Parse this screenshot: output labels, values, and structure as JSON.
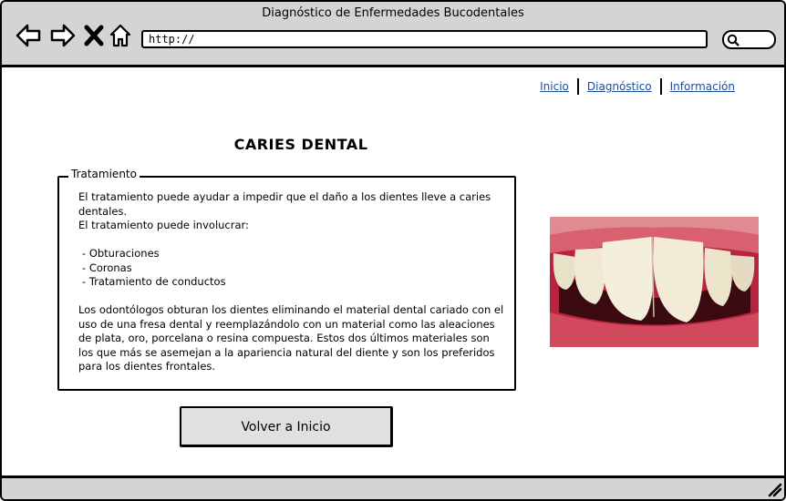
{
  "window": {
    "title": "Diagnóstico de Enfermedades Bucodentales",
    "url": "http://"
  },
  "toolbar": {
    "back_icon": "arrow-left-icon",
    "forward_icon": "arrow-right-icon",
    "stop_icon": "close-icon",
    "home_icon": "home-icon",
    "search_icon": "search-icon"
  },
  "nav": {
    "links": [
      "Inicio",
      "Diagnóstico",
      "Información"
    ]
  },
  "page": {
    "title": "CARIES DENTAL"
  },
  "treatment": {
    "legend": "Tratamiento",
    "intro": "El tratamiento puede ayudar a impedir que el daño a los dientes lleve a caries dentales.",
    "lead": "El tratamiento puede involucrar:",
    "options": [
      "Obturaciones",
      "Coronas",
      "Tratamiento de conductos"
    ],
    "details": "Los odontólogos obturan los dientes eliminando el material dental cariado con el uso de una fresa dental y reemplazándolo con un material como las aleaciones de plata, oro, porcelana o resina compuesta. Estos dos últimos materiales son los que más se asemejan a la apariencia natural del diente y son los preferidos para los dientes frontales."
  },
  "actions": {
    "back_home": "Volver a Inicio"
  },
  "colors": {
    "chrome": "#d4d4d4",
    "link": "#1a4b9c",
    "button": "#e0e0e0"
  }
}
